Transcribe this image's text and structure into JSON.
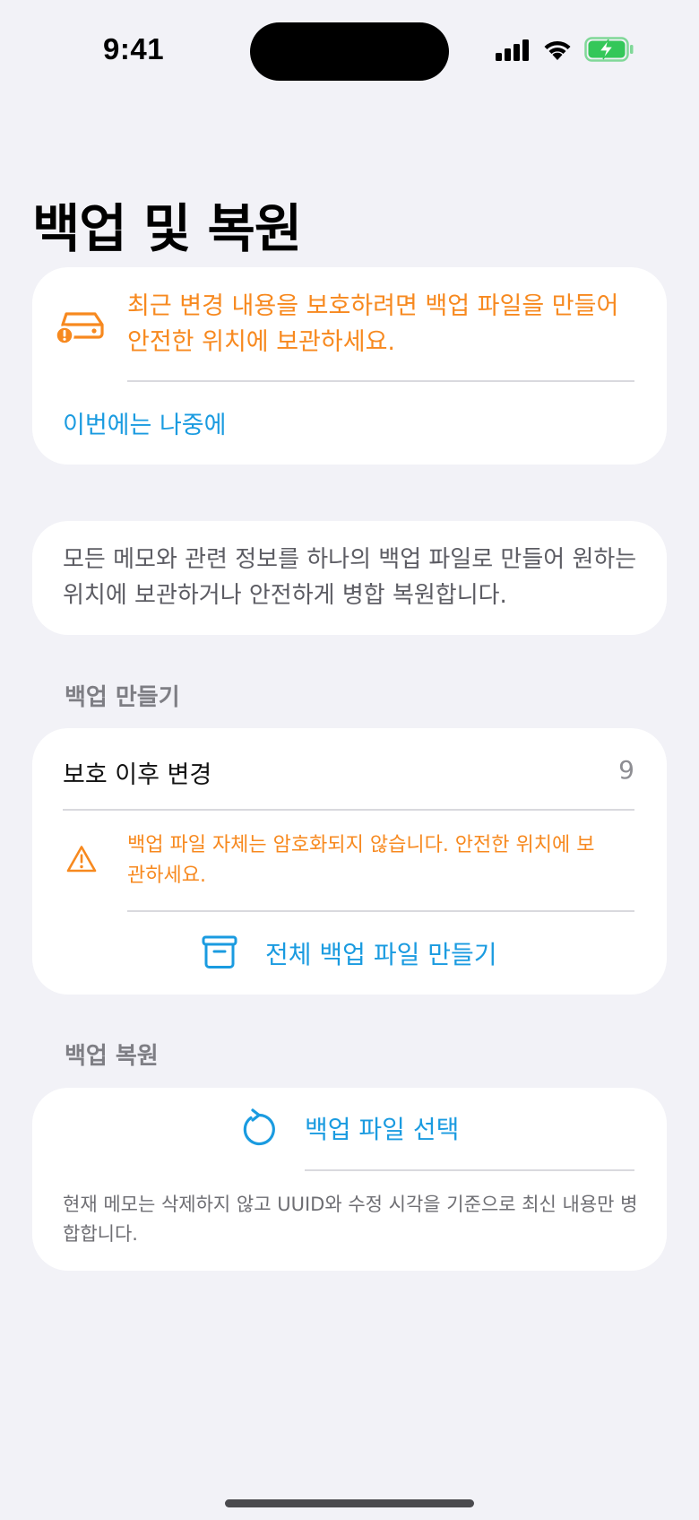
{
  "status_bar": {
    "time": "9:41"
  },
  "page": {
    "title": "백업 및 복원"
  },
  "alert": {
    "icon": "drive-warning-icon",
    "message": "최근 변경 내용을 보호하려면 백업 파일을 만들어 안전한 위치에 보관하세요.",
    "later_label": "이번에는 나중에"
  },
  "description": {
    "text": "모든 메모와 관련 정보를 하나의 백업 파일로 만들어 원하는 위치에 보관하거나 안전하게 병합 복원합니다."
  },
  "create_section": {
    "header": "백업 만들기",
    "changes_label": "보호 이후 변경",
    "changes_count": "9",
    "warning_icon": "warning-triangle-icon",
    "warning_text": "백업 파일 자체는 암호화되지 않습니다. 안전한 위치에 보관하세요.",
    "button_icon": "archive-box-icon",
    "button_label": "전체 백업 파일 만들기"
  },
  "restore_section": {
    "header": "백업 복원",
    "button_icon": "restore-arrow-icon",
    "button_label": "백업 파일 선택",
    "note": "현재 메모는 삭제하지 않고 UUID와 수정 시각을 기준으로 최신 내용만 병합합니다."
  },
  "colors": {
    "background": "#F2F2F7",
    "accent_blue": "#1A9BE0",
    "warning_orange": "#F7891F",
    "battery_green": "#34C759"
  }
}
